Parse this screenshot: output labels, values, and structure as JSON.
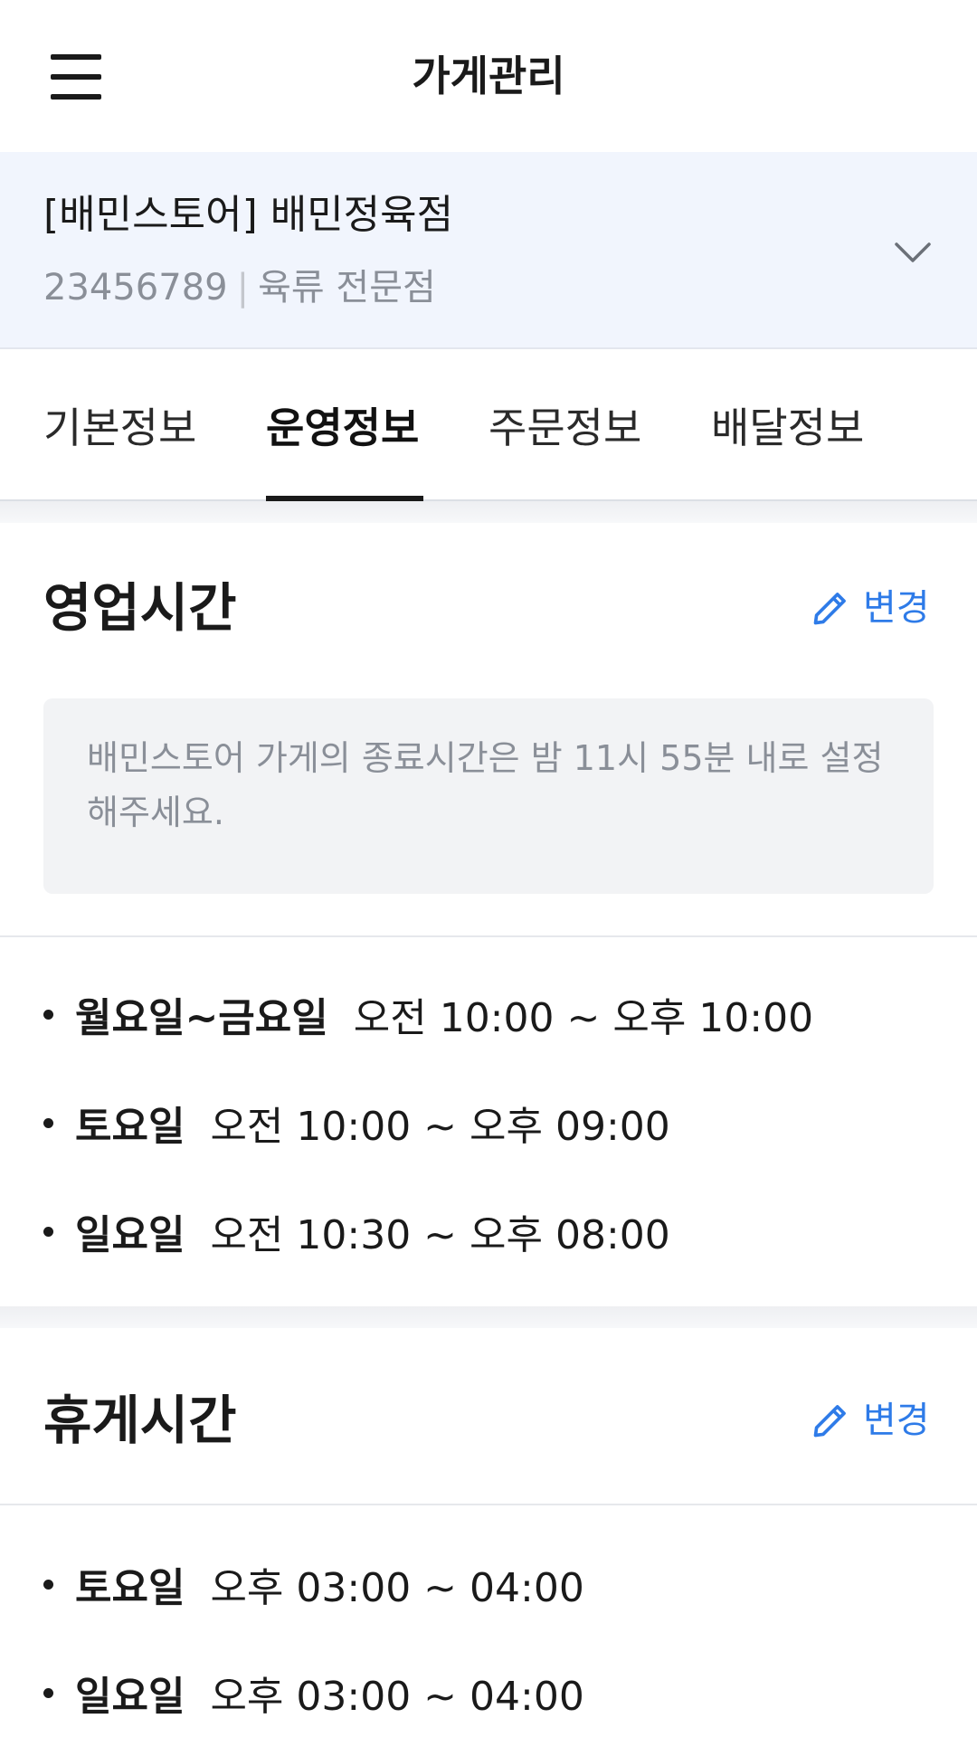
{
  "header": {
    "title": "가게관리"
  },
  "store": {
    "name": "[배민스토어] 배민정육점",
    "id": "23456789",
    "category": "육류 전문점"
  },
  "tabs": [
    {
      "label": "기본정보",
      "active": false
    },
    {
      "label": "운영정보",
      "active": true
    },
    {
      "label": "주문정보",
      "active": false
    },
    {
      "label": "배달정보",
      "active": false
    }
  ],
  "business_hours": {
    "title": "영업시간",
    "edit_label": "변경",
    "notice": "배민스토어 가게의 종료시간은 밤 11시 55분 내로 설정해주세요.",
    "rows": [
      {
        "day": "월요일~금요일",
        "time": "오전 10:00 ~ 오후 10:00"
      },
      {
        "day": "토요일",
        "time": "오전 10:00 ~ 오후 09:00"
      },
      {
        "day": "일요일",
        "time": "오전 10:30 ~ 오후 08:00"
      }
    ]
  },
  "break_time": {
    "title": "휴게시간",
    "edit_label": "변경",
    "rows": [
      {
        "day": "토요일",
        "time": "오후 03:00 ~ 04:00"
      },
      {
        "day": "일요일",
        "time": "오후 03:00 ~ 04:00"
      }
    ]
  },
  "colors": {
    "accent": "#2e7be8",
    "store_bar_bg": "#f1f5fd",
    "notice_bg": "#f2f3f5"
  }
}
